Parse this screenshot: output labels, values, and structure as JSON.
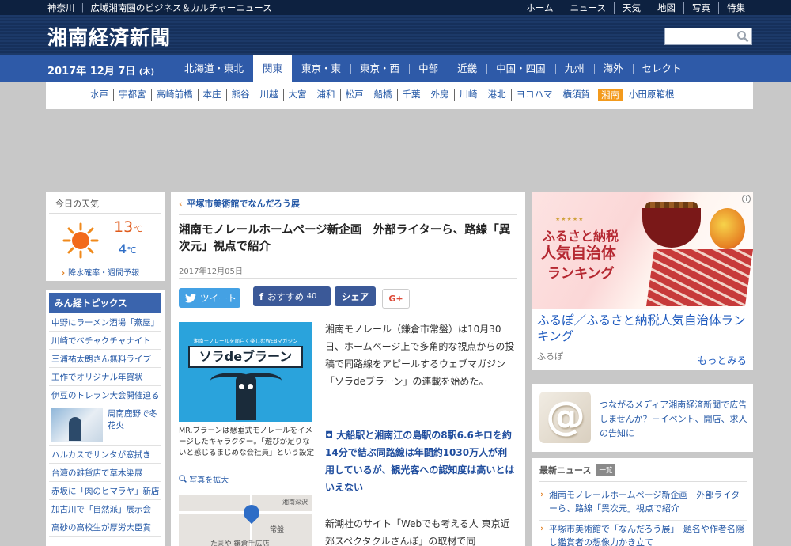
{
  "header": {
    "region": "神奈川",
    "tagline": "広域湘南圏のビジネス＆カルチャーニュース",
    "topnav": [
      "ホーム",
      "ニュース",
      "天気",
      "地図",
      "写真",
      "特集"
    ],
    "logo": "湘南経済新聞",
    "search_placeholder": ""
  },
  "regionbar": {
    "date": "2017年 12月 7日",
    "weekday": "(木)",
    "tabs": [
      "北海道・東北",
      "関東",
      "東京・東",
      "東京・西",
      "中部",
      "近畿",
      "中国・四国",
      "九州",
      "海外",
      "セレクト"
    ],
    "active_tab": "関東"
  },
  "cities": {
    "items": [
      "水戸",
      "宇都宮",
      "高崎前橋",
      "本庄",
      "熊谷",
      "川越",
      "大宮",
      "浦和",
      "松戸",
      "船橋",
      "千葉",
      "外房",
      "川崎",
      "港北",
      "ヨコハマ",
      "横須賀",
      "湘南",
      "小田原箱根"
    ],
    "active": "湘南",
    "active_color": "#f39a1c"
  },
  "weather": {
    "title": "今日の天気",
    "icon": "sun-icon",
    "high": "13",
    "low": "4",
    "unit": "℃",
    "link": "降水確率・週間予報"
  },
  "topics": {
    "title": "みん経トピックス",
    "items": [
      "中野にラーメン酒場「燕屋」",
      "川崎でベチャクチャナイト",
      "三浦祐太朗さん無料ライブ",
      "工作でオリジナル年賀状",
      "伊豆のトレラン大会開催迫る",
      "周南鹿野で冬花火",
      "ハルカスでサンタが窓拭き",
      "台湾の雑貨店で草木染展",
      "赤坂に「肉のヒマラヤ」新店",
      "加古川で「自然派」展示会",
      "高砂の高校生が厚労大臣賞"
    ]
  },
  "article": {
    "breadcrumb": "平塚市美術館でなんだろう展",
    "title": "湘南モノレールホームページ新企画　外部ライターら、路線「異次元」視点で紹介",
    "date": "2017年12月05日",
    "share": {
      "tweet": "ツイート",
      "recommend": "おすすめ",
      "recommend_count": "40",
      "share": "シェア",
      "gplus": "G+"
    },
    "image1": {
      "band_text": "湘南モノレールを面白く楽しむWEBマガジン",
      "title_text": "ソラdeブラーン"
    },
    "caption1": "MR.ブラーンは懸垂式モノレールをイメージしたキャラクター。「遊びが足りないと感じるまじめな会社員」という設定",
    "zoom_label": "写真を拡大",
    "image2": {
      "label_top": "湘南深沢",
      "label_mid": "常盤",
      "label_bottom": "たまや 鎌倉手広店"
    },
    "body1": "湘南モノレール（鎌倉市常盤）は10月30日、ホームページ上で多角的な視点からの投稿で同路線をアピールするウェブマガジン「ソラdeブラーン」の連載を始めた。",
    "lead": "大船駅と湘南江の島駅の8駅6.6キロを約14分で結ぶ同路線は年間約1030万人が利用しているが、観光客への認知度は高いとはいえない",
    "body2": "新潮社のサイト「Webでも考える人 東京近郊スペクタクルさんぽ」の取材で同"
  },
  "ad": {
    "stars": "★★★★★",
    "line1": "ふるさと納税",
    "line2": "人気自治体",
    "line3": "ランキング",
    "title": "ふるぽ／ふるさと納税人気自治体ランキング",
    "source": "ふるぽ",
    "more": "もっとみる",
    "info": "i"
  },
  "promo": {
    "text": "つながるメディア湘南経済新聞で広告しませんか？－イベント、開店、求人の告知に"
  },
  "news": {
    "title": "最新ニュース",
    "badge": "一覧",
    "items": [
      "湘南モノレールホームページ新企画　外部ライターら、路線「異次元」視点で紹介",
      "平塚市美術館で「なんだろう展」　題名や作者名隠し鑑賞者の想像力かき立て"
    ]
  }
}
